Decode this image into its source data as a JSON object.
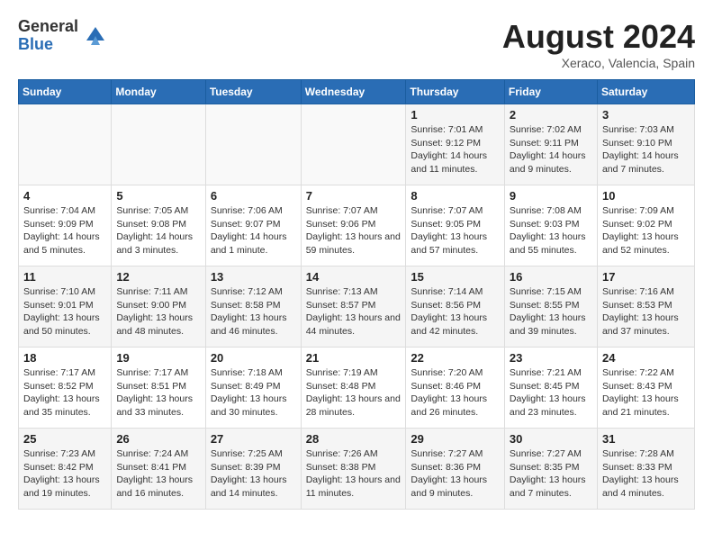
{
  "header": {
    "logo_line1": "General",
    "logo_line2": "Blue",
    "month_year": "August 2024",
    "location": "Xeraco, Valencia, Spain"
  },
  "days_of_week": [
    "Sunday",
    "Monday",
    "Tuesday",
    "Wednesday",
    "Thursday",
    "Friday",
    "Saturday"
  ],
  "weeks": [
    [
      {
        "day": "",
        "info": ""
      },
      {
        "day": "",
        "info": ""
      },
      {
        "day": "",
        "info": ""
      },
      {
        "day": "",
        "info": ""
      },
      {
        "day": "1",
        "info": "Sunrise: 7:01 AM\nSunset: 9:12 PM\nDaylight: 14 hours and 11 minutes."
      },
      {
        "day": "2",
        "info": "Sunrise: 7:02 AM\nSunset: 9:11 PM\nDaylight: 14 hours and 9 minutes."
      },
      {
        "day": "3",
        "info": "Sunrise: 7:03 AM\nSunset: 9:10 PM\nDaylight: 14 hours and 7 minutes."
      }
    ],
    [
      {
        "day": "4",
        "info": "Sunrise: 7:04 AM\nSunset: 9:09 PM\nDaylight: 14 hours and 5 minutes."
      },
      {
        "day": "5",
        "info": "Sunrise: 7:05 AM\nSunset: 9:08 PM\nDaylight: 14 hours and 3 minutes."
      },
      {
        "day": "6",
        "info": "Sunrise: 7:06 AM\nSunset: 9:07 PM\nDaylight: 14 hours and 1 minute."
      },
      {
        "day": "7",
        "info": "Sunrise: 7:07 AM\nSunset: 9:06 PM\nDaylight: 13 hours and 59 minutes."
      },
      {
        "day": "8",
        "info": "Sunrise: 7:07 AM\nSunset: 9:05 PM\nDaylight: 13 hours and 57 minutes."
      },
      {
        "day": "9",
        "info": "Sunrise: 7:08 AM\nSunset: 9:03 PM\nDaylight: 13 hours and 55 minutes."
      },
      {
        "day": "10",
        "info": "Sunrise: 7:09 AM\nSunset: 9:02 PM\nDaylight: 13 hours and 52 minutes."
      }
    ],
    [
      {
        "day": "11",
        "info": "Sunrise: 7:10 AM\nSunset: 9:01 PM\nDaylight: 13 hours and 50 minutes."
      },
      {
        "day": "12",
        "info": "Sunrise: 7:11 AM\nSunset: 9:00 PM\nDaylight: 13 hours and 48 minutes."
      },
      {
        "day": "13",
        "info": "Sunrise: 7:12 AM\nSunset: 8:58 PM\nDaylight: 13 hours and 46 minutes."
      },
      {
        "day": "14",
        "info": "Sunrise: 7:13 AM\nSunset: 8:57 PM\nDaylight: 13 hours and 44 minutes."
      },
      {
        "day": "15",
        "info": "Sunrise: 7:14 AM\nSunset: 8:56 PM\nDaylight: 13 hours and 42 minutes."
      },
      {
        "day": "16",
        "info": "Sunrise: 7:15 AM\nSunset: 8:55 PM\nDaylight: 13 hours and 39 minutes."
      },
      {
        "day": "17",
        "info": "Sunrise: 7:16 AM\nSunset: 8:53 PM\nDaylight: 13 hours and 37 minutes."
      }
    ],
    [
      {
        "day": "18",
        "info": "Sunrise: 7:17 AM\nSunset: 8:52 PM\nDaylight: 13 hours and 35 minutes."
      },
      {
        "day": "19",
        "info": "Sunrise: 7:17 AM\nSunset: 8:51 PM\nDaylight: 13 hours and 33 minutes."
      },
      {
        "day": "20",
        "info": "Sunrise: 7:18 AM\nSunset: 8:49 PM\nDaylight: 13 hours and 30 minutes."
      },
      {
        "day": "21",
        "info": "Sunrise: 7:19 AM\nSunset: 8:48 PM\nDaylight: 13 hours and 28 minutes."
      },
      {
        "day": "22",
        "info": "Sunrise: 7:20 AM\nSunset: 8:46 PM\nDaylight: 13 hours and 26 minutes."
      },
      {
        "day": "23",
        "info": "Sunrise: 7:21 AM\nSunset: 8:45 PM\nDaylight: 13 hours and 23 minutes."
      },
      {
        "day": "24",
        "info": "Sunrise: 7:22 AM\nSunset: 8:43 PM\nDaylight: 13 hours and 21 minutes."
      }
    ],
    [
      {
        "day": "25",
        "info": "Sunrise: 7:23 AM\nSunset: 8:42 PM\nDaylight: 13 hours and 19 minutes."
      },
      {
        "day": "26",
        "info": "Sunrise: 7:24 AM\nSunset: 8:41 PM\nDaylight: 13 hours and 16 minutes."
      },
      {
        "day": "27",
        "info": "Sunrise: 7:25 AM\nSunset: 8:39 PM\nDaylight: 13 hours and 14 minutes."
      },
      {
        "day": "28",
        "info": "Sunrise: 7:26 AM\nSunset: 8:38 PM\nDaylight: 13 hours and 11 minutes."
      },
      {
        "day": "29",
        "info": "Sunrise: 7:27 AM\nSunset: 8:36 PM\nDaylight: 13 hours and 9 minutes."
      },
      {
        "day": "30",
        "info": "Sunrise: 7:27 AM\nSunset: 8:35 PM\nDaylight: 13 hours and 7 minutes."
      },
      {
        "day": "31",
        "info": "Sunrise: 7:28 AM\nSunset: 8:33 PM\nDaylight: 13 hours and 4 minutes."
      }
    ]
  ]
}
